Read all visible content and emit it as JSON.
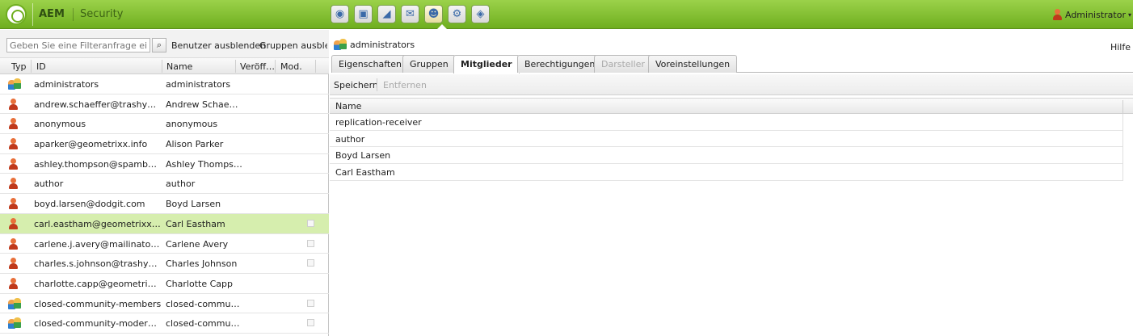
{
  "header": {
    "brand": "AEM",
    "page": "Security",
    "toolbar": [
      {
        "icon": "globe-icon",
        "glyph": "◉"
      },
      {
        "icon": "camera-icon",
        "glyph": "▣"
      },
      {
        "icon": "megaphone-icon",
        "glyph": "◢"
      },
      {
        "icon": "envelope-icon",
        "glyph": "✉"
      },
      {
        "icon": "users-icon",
        "glyph": "☻"
      },
      {
        "icon": "gears-icon",
        "glyph": "⚙"
      },
      {
        "icon": "tag-icon",
        "glyph": "◈"
      }
    ],
    "user": "Administrator",
    "user_caret": "▾"
  },
  "left": {
    "filter_placeholder": "Geben Sie eine Filteranfrage ein",
    "search_glyph": "⌕",
    "hide_users": "Benutzer ausblenden",
    "hide_groups": "Gruppen ausblenden",
    "columns": {
      "type": "Typ",
      "id": "ID",
      "name": "Name",
      "published": "Veröff…",
      "modified": "Mod."
    },
    "rows": [
      {
        "type": "group",
        "id": "administrators",
        "name": "administrators",
        "check": false,
        "selected": false
      },
      {
        "type": "user",
        "id": "andrew.schaeffer@trashyma...",
        "name": "Andrew Schaeffer",
        "check": false,
        "selected": false
      },
      {
        "type": "user",
        "id": "anonymous",
        "name": "anonymous",
        "check": false,
        "selected": false
      },
      {
        "type": "user",
        "id": "aparker@geometrixx.info",
        "name": "Alison Parker",
        "check": false,
        "selected": false
      },
      {
        "type": "user",
        "id": "ashley.thompson@spambob....",
        "name": "Ashley Thompson",
        "check": false,
        "selected": false
      },
      {
        "type": "user",
        "id": "author",
        "name": "author",
        "check": false,
        "selected": false
      },
      {
        "type": "user",
        "id": "boyd.larsen@dodgit.com",
        "name": "Boyd Larsen",
        "check": false,
        "selected": false
      },
      {
        "type": "user",
        "id": "carl.eastham@geometrixx-m...",
        "name": "Carl Eastham",
        "check": true,
        "selected": true
      },
      {
        "type": "user",
        "id": "carlene.j.avery@mailinator.c...",
        "name": "Carlene Avery",
        "check": true,
        "selected": false
      },
      {
        "type": "user",
        "id": "charles.s.johnson@trashyma...",
        "name": "Charles Johnson",
        "check": true,
        "selected": false
      },
      {
        "type": "user",
        "id": "charlotte.capp@geometrixx-...",
        "name": "Charlotte Capp",
        "check": false,
        "selected": false
      },
      {
        "type": "group",
        "id": "closed-community-members",
        "name": "closed-communit...",
        "check": true,
        "selected": false
      },
      {
        "type": "group",
        "id": "closed-community-moderators",
        "name": "closed-communit...",
        "check": true,
        "selected": false
      }
    ]
  },
  "right": {
    "title": "administrators",
    "help": "Hilfe",
    "tabs": [
      {
        "label": "Eigenschaften",
        "state": "normal"
      },
      {
        "label": "Gruppen",
        "state": "normal"
      },
      {
        "label": "Mitglieder",
        "state": "active"
      },
      {
        "label": "Berechtigungen",
        "state": "normal"
      },
      {
        "label": "Darsteller",
        "state": "disabled"
      },
      {
        "label": "Voreinstellungen",
        "state": "normal"
      }
    ],
    "save": "Speichern",
    "remove": "Entfernen",
    "members_header": "Name",
    "members": [
      "replication-receiver",
      "author",
      "Boyd Larsen",
      "Carl Eastham"
    ]
  },
  "colors": {
    "header_green": "#8cc63f",
    "selected_row": "#d6eeae"
  }
}
